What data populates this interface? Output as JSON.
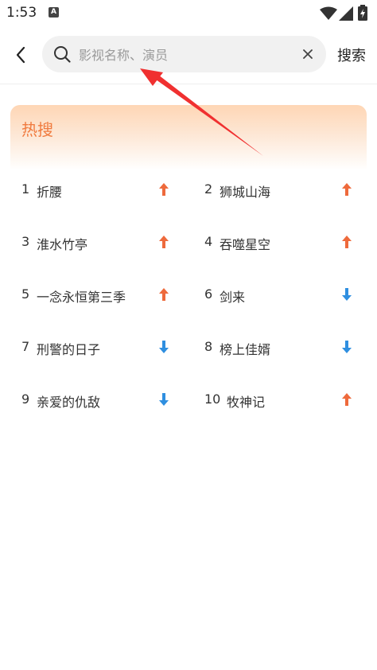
{
  "status_bar": {
    "time": "1:53",
    "notification_icon": "a-icon",
    "icons": [
      "wifi-icon",
      "signal-icon",
      "battery-icon"
    ]
  },
  "search_bar": {
    "placeholder": "影视名称、演员",
    "value": "",
    "search_label": "搜索"
  },
  "hot_search": {
    "title": "热搜",
    "items": [
      {
        "rank": "1",
        "name": "折腰",
        "trend": "up"
      },
      {
        "rank": "2",
        "name": "狮城山海",
        "trend": "up"
      },
      {
        "rank": "3",
        "name": "淮水竹亭",
        "trend": "up"
      },
      {
        "rank": "4",
        "name": "吞噬星空",
        "trend": "up"
      },
      {
        "rank": "5",
        "name": "一念永恒第三季",
        "trend": "up"
      },
      {
        "rank": "6",
        "name": "剑来",
        "trend": "down"
      },
      {
        "rank": "7",
        "name": "刑警的日子",
        "trend": "down"
      },
      {
        "rank": "8",
        "name": "榜上佳婿",
        "trend": "down"
      },
      {
        "rank": "9",
        "name": "亲爱的仇敌",
        "trend": "down"
      },
      {
        "rank": "10",
        "name": "牧神记",
        "trend": "up"
      }
    ]
  },
  "colors": {
    "accent": "#f07b3f",
    "trend_up": "#ee6a3c",
    "trend_down": "#2f8fe0",
    "annotation": "#f03030"
  }
}
